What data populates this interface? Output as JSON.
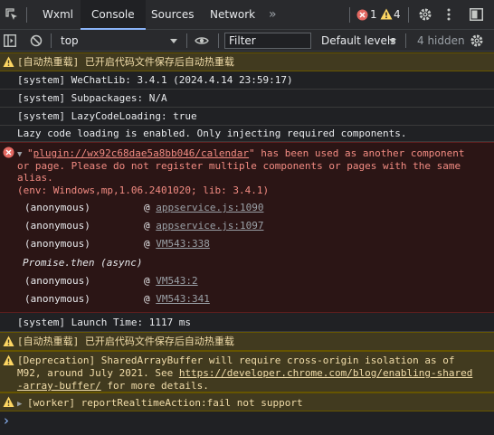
{
  "tabs": {
    "items": [
      {
        "label": "Wxml"
      },
      {
        "label": "Console"
      },
      {
        "label": "Sources"
      },
      {
        "label": "Network"
      }
    ],
    "overflow": "»",
    "error_count": "1",
    "warning_count": "4"
  },
  "toolbar": {
    "context": "top",
    "filter_placeholder": "Filter",
    "levels": "Default levels",
    "hidden": "4 hidden"
  },
  "messages": {
    "warn1": "[自动热重载] 已开启代码文件保存后自动热重载",
    "lib": "[system] WeChatLib: 3.4.1 (2024.4.14 23:59:17)",
    "subpkg": "[system] Subpackages: N/A",
    "lazy": "[system] LazyCodeLoading: true",
    "lazy_info": "Lazy code loading is enabled. Only injecting required components.",
    "error": {
      "quote_open": "\"",
      "plugin": "plugin://wx92c68dae5a8bb046/calendar",
      "line1_rest": "\" has been used as another component",
      "line2": "or page. Please do not register multiple components or pages with the same",
      "line3": "alias.",
      "line4": "(env: Windows,mp,1.06.2401020; lib: 3.4.1)",
      "stack": [
        {
          "fn": "(anonymous)",
          "at": "@",
          "src": "appservice.js:1090"
        },
        {
          "fn": "(anonymous)",
          "at": "@",
          "src": "appservice.js:1097"
        },
        {
          "fn": "(anonymous)",
          "at": "@",
          "src": "VM543:338"
        }
      ],
      "async_label": "Promise.then (async)",
      "stack2": [
        {
          "fn": "(anonymous)",
          "at": "@",
          "src": "VM543:2"
        },
        {
          "fn": "(anonymous)",
          "at": "@",
          "src": "VM543:341"
        }
      ]
    },
    "launch": "[system] Launch Time: 1117 ms",
    "warn2": "[自动热重载] 已开启代码文件保存后自动热重载",
    "deprecation": {
      "line1": "[Deprecation] SharedArrayBuffer will require cross-origin isolation as of",
      "line2_pre": "M92, around July 2021. See ",
      "link_part1": "https://developer.chrome.com/blog/enabling-shared",
      "link_part2": "-array-buffer/",
      "line3_rest": " for more details."
    },
    "worker": "[worker] reportRealtimeAction:fail not support"
  },
  "prompt_symbol": "›",
  "colors": {
    "background": "#202124",
    "warning_bg": "#413a1f",
    "warning_text": "#f2ddaa",
    "error_bg": "#2b1515",
    "error_text": "#f28b82",
    "accent": "#8ab4f8"
  }
}
